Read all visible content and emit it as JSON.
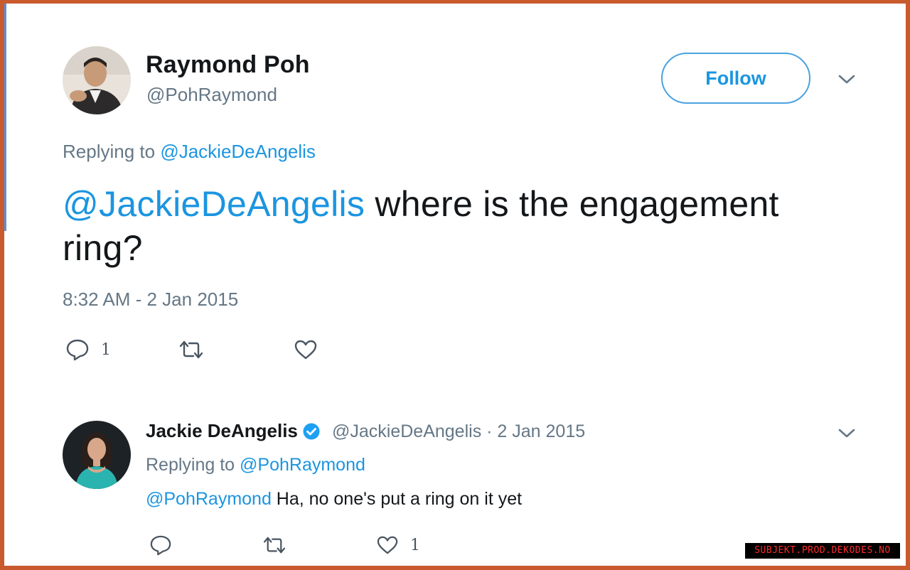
{
  "tweet": {
    "author_name": "Raymond Poh",
    "author_handle": "@PohRaymond",
    "follow_label": "Follow",
    "replying_prefix": "Replying to",
    "replying_to": "@JackieDeAngelis",
    "text_mention": "@JackieDeAngelis",
    "text_body": " where is the engagement ring?",
    "timestamp": "8:32 AM - 2 Jan 2015",
    "reply_count": "1",
    "retweet_count": "",
    "like_count": ""
  },
  "reply": {
    "author_name": "Jackie DeAngelis",
    "verified": true,
    "meta": "@JackieDeAngelis · 2 Jan 2015",
    "replying_prefix": "Replying to",
    "replying_to": "@PohRaymond",
    "text_mention": "@PohRaymond",
    "text_body": " Ha, no one's put a ring on it yet",
    "reply_count": "",
    "retweet_count": "",
    "like_count": "1"
  },
  "watermark": "SUBJEKT.PROD.DEKODES.NO",
  "icons": {
    "reply": "reply-icon",
    "retweet": "retweet-icon",
    "like": "heart-icon",
    "more": "chevron-down-icon",
    "verified": "verified-badge-icon"
  },
  "colors": {
    "link": "#1b95e0",
    "secondary_text": "#657786",
    "frame": "#c85a2e",
    "verified": "#1da1f2"
  }
}
